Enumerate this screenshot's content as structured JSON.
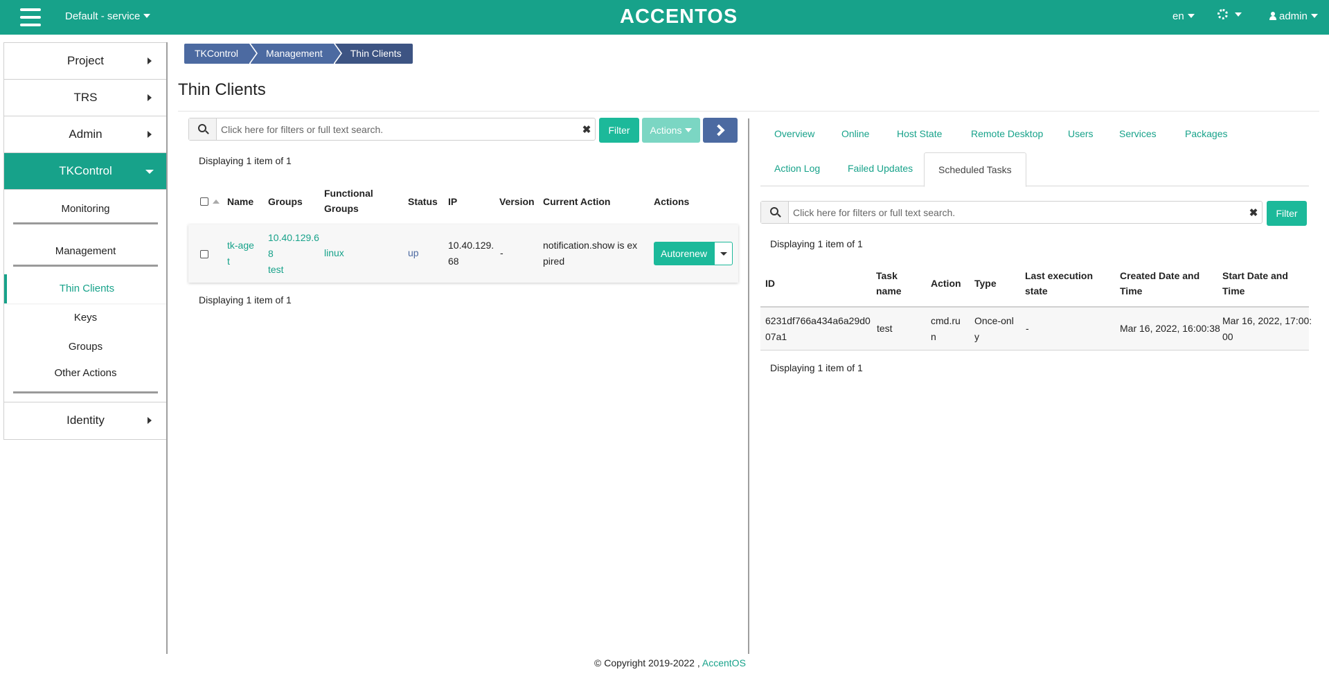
{
  "topbar": {
    "project": "Default - service",
    "logo": "ACCENTOS",
    "language": "en",
    "user": "admin"
  },
  "sidebar": {
    "items": [
      {
        "label": "Project"
      },
      {
        "label": "TRS"
      },
      {
        "label": "Admin"
      },
      {
        "label": "TKControl"
      },
      {
        "label": "Identity"
      }
    ],
    "tkcontrol_sub": {
      "monitoring": "Monitoring",
      "management": "Management",
      "thin_clients": "Thin Clients",
      "keys": "Keys",
      "groups": "Groups",
      "other_actions": "Other Actions"
    }
  },
  "breadcrumb": [
    "TKControl",
    "Management",
    "Thin Clients"
  ],
  "page_title": "Thin Clients",
  "left_panel": {
    "search_placeholder": "Click here for filters or full text search.",
    "filter_label": "Filter",
    "actions_label": "Actions",
    "displaying_top": "Displaying 1 item of 1",
    "displaying_bottom": "Displaying 1 item of 1",
    "columns": {
      "name": "Name",
      "groups": "Groups",
      "functional_groups_1": "Functional",
      "functional_groups_2": "Groups",
      "status": "Status",
      "ip": "IP",
      "version": "Version",
      "current_action": "Current Action",
      "actions": "Actions"
    },
    "row": {
      "name_1": "tk-age",
      "name_2": "t",
      "groups_1": "10.40.129.6",
      "groups_2": "8",
      "groups_3": "test",
      "functional_group": "linux",
      "status": "up",
      "ip_1": "10.40.129.",
      "ip_2": "68",
      "version": "-",
      "current_action_1": "notification.show is ex",
      "current_action_2": "pired",
      "action_button": "Autorenew"
    }
  },
  "right_panel": {
    "tabs_row1": [
      "Overview",
      "Online",
      "Host State",
      "Remote Desktop",
      "Users",
      "Services",
      "Packages"
    ],
    "tabs_row2": [
      "Action Log",
      "Failed Updates",
      "Scheduled Tasks"
    ],
    "search_placeholder": "Click here for filters or full text search.",
    "filter_label": "Filter",
    "displaying_top": "Displaying 1 item of 1",
    "displaying_bottom": "Displaying 1 item of 1",
    "columns": {
      "id": "ID",
      "task_name_1": "Task",
      "task_name_2": "name",
      "action": "Action",
      "type": "Type",
      "last_state_1": "Last execution",
      "last_state_2": "state",
      "created_1": "Created Date and",
      "created_2": "Time",
      "start_1": "Start Date and",
      "start_2": "Time"
    },
    "row": {
      "id_1": "6231df766a434a6a29d0",
      "id_2": "07a1",
      "task_name": "test",
      "action_1": "cmd.ru",
      "action_2": "n",
      "type_1": "Once-onl",
      "type_2": "y",
      "last_state": "-",
      "created": "Mar 16, 2022, 16:00:38",
      "start_1": "Mar 16, 2022, 17:00:",
      "start_2": "00"
    }
  },
  "footer": {
    "copyright": "© Copyright 2019-2022 ,",
    "brand_link": "AccentOS"
  },
  "colors": {
    "brand": "#17a28a",
    "button_green": "#1cb99a",
    "breadcrumb_blue": "#4c6aa1"
  }
}
